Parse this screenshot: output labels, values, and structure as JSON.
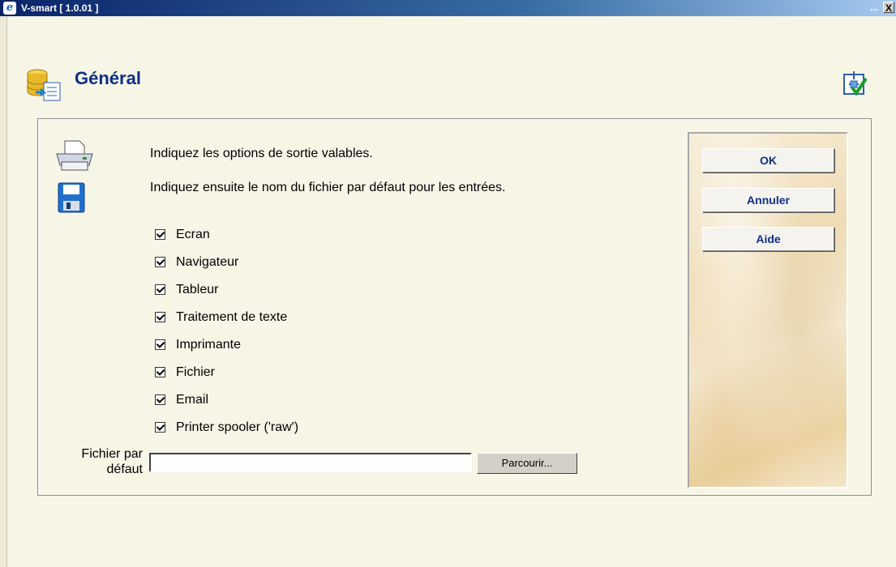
{
  "window": {
    "title": "V-smart [ 1.0.01 ]",
    "more_glyph": "...",
    "close_glyph": "X",
    "app_icon_glyph": "e"
  },
  "header": {
    "title": "Général",
    "icon": "database-export-icon",
    "setup_icon": "setup-check-icon"
  },
  "instructions": {
    "line1": "Indiquez les options de sortie valables.",
    "line2": "Indiquez ensuite le nom du fichier par défaut pour les entrées."
  },
  "options": [
    {
      "label": "Ecran",
      "checked": true
    },
    {
      "label": "Navigateur",
      "checked": true
    },
    {
      "label": "Tableur",
      "checked": true
    },
    {
      "label": "Traitement de texte",
      "checked": true
    },
    {
      "label": "Imprimante",
      "checked": true
    },
    {
      "label": "Fichier",
      "checked": true
    },
    {
      "label": "Email",
      "checked": true
    },
    {
      "label": "Printer spooler ('raw')",
      "checked": true
    }
  ],
  "default_file": {
    "label": "Fichier par défaut",
    "value": "",
    "browse_label": "Parcourir..."
  },
  "buttons": {
    "ok": "OK",
    "cancel": "Annuler",
    "help": "Aide"
  },
  "colors": {
    "title_blue": "#0c2f87",
    "background": "#f7f5e6"
  }
}
